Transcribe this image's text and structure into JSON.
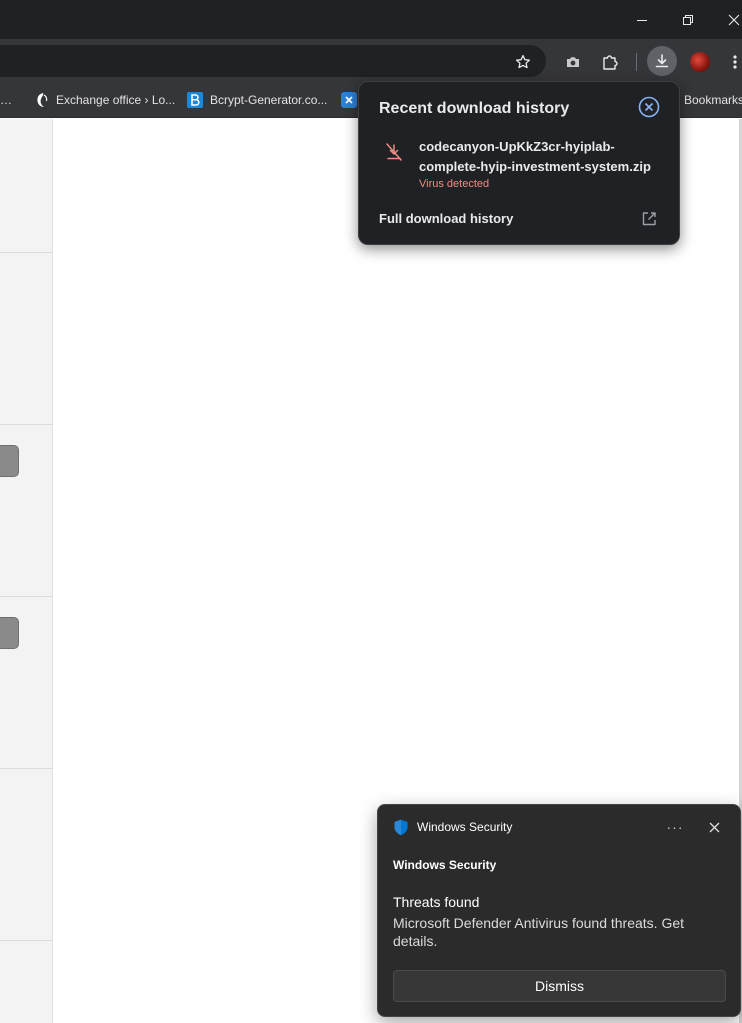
{
  "window_controls": {
    "minimize_icon": "minimize-icon",
    "restore_icon": "restore-icon",
    "close_icon": "close-icon"
  },
  "toolbar": {
    "icons": [
      "star-icon",
      "camera-icon",
      "extensions-icon",
      "download-icon",
      "avatar",
      "more-icon"
    ]
  },
  "bookmarks": {
    "items": [
      {
        "label": "…",
        "icon": "partial-icon"
      },
      {
        "label": "Exchange office › Lo...",
        "icon": "exchange-icon"
      },
      {
        "label": "Bcrypt-Generator.co...",
        "icon": "bcrypt-icon"
      },
      {
        "label": "",
        "icon": "x-icon"
      },
      {
        "label": "Bookmarks",
        "icon": "folder-icon"
      }
    ]
  },
  "download_popup": {
    "title": "Recent download history",
    "file": {
      "name": "codecanyon-UpKkZ3cr-hyiplab-complete-hyip-investment-system.zip",
      "status": "Virus detected"
    },
    "full_history_label": "Full download history",
    "colors": {
      "status": "#f28b82",
      "background": "#202124"
    }
  },
  "toast": {
    "app_name": "Windows Security",
    "more_label": "···",
    "header": "Windows Security",
    "title": "Threats found",
    "body": "Microsoft Defender Antivirus found threats. Get details.",
    "dismiss_label": "Dismiss",
    "colors": {
      "background": "#2b2b2b",
      "shield": "#0078d4"
    }
  }
}
